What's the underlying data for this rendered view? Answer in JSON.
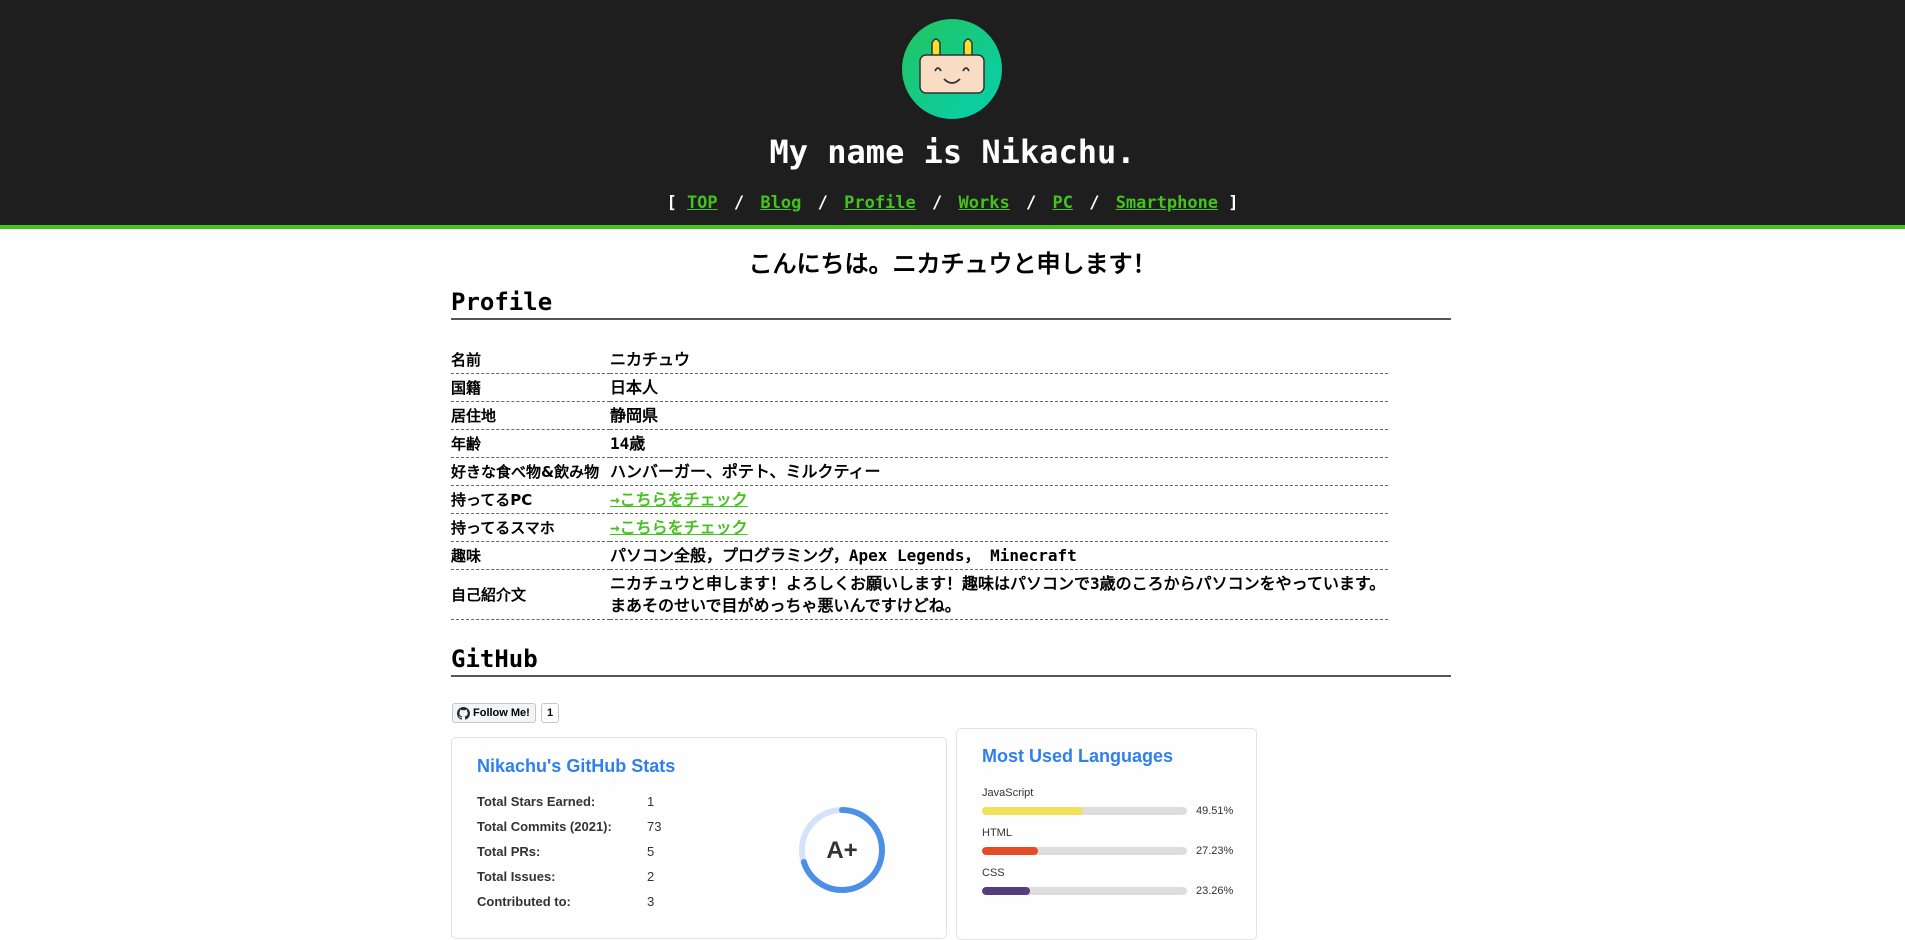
{
  "header": {
    "title": "My name is Nikachu.",
    "nav_open": "[",
    "nav_close": "]",
    "nav": [
      "TOP",
      "Blog",
      "Profile",
      "Works",
      "PC",
      "Smartphone"
    ],
    "separator": "/"
  },
  "greeting": "こんにちは。ニカチュウと申します！",
  "profile": {
    "title": "Profile",
    "rows": [
      {
        "key": "名前",
        "value": "ニカチュウ"
      },
      {
        "key": "国籍",
        "value": "日本人"
      },
      {
        "key": "居住地",
        "value": "静岡県"
      },
      {
        "key": "年齢",
        "value": "14歳"
      },
      {
        "key": "好きな食べ物&飲み物",
        "value": "ハンバーガー、ポテト、ミルクティー"
      },
      {
        "key": "持ってるPC",
        "value": "→こちらをチェック"
      },
      {
        "key": "持ってるスマホ",
        "value": "→こちらをチェック"
      },
      {
        "key": "趣味",
        "value": "パソコン全般，プログラミング，Apex Legends， Minecraft"
      },
      {
        "key": "自己紹介文",
        "value_line1": "ニカチュウと申します！よろしくお願いします！趣味はパソコンで3歳のころからパソコンをやっています。",
        "value_line2": "まあそのせいで目がめっちゃ悪いんですけどね。"
      }
    ]
  },
  "github": {
    "title": "GitHub",
    "follow_label": "Follow Me!",
    "follow_count": "1",
    "stats": {
      "title": "Nikachu's GitHub Stats",
      "rows": [
        {
          "label": "Total Stars Earned:",
          "value": "1"
        },
        {
          "label": "Total Commits (2021):",
          "value": "73"
        },
        {
          "label": "Total PRs:",
          "value": "5"
        },
        {
          "label": "Total Issues:",
          "value": "2"
        },
        {
          "label": "Contributed to:",
          "value": "3"
        }
      ],
      "rank": "A+",
      "rank_progress": 0.7
    },
    "languages": {
      "title": "Most Used Languages",
      "items": [
        {
          "name": "JavaScript",
          "percent": "49.51%",
          "fraction": 0.4951,
          "color": "#f1e05a"
        },
        {
          "name": "HTML",
          "percent": "27.23%",
          "fraction": 0.2723,
          "color": "#e34c26"
        },
        {
          "name": "CSS",
          "percent": "23.26%",
          "fraction": 0.2326,
          "color": "#563d7c"
        }
      ]
    }
  },
  "colors": {
    "accent": "#45c21f",
    "header_bg": "#1e1e1e",
    "card_title": "#2f80ed"
  }
}
